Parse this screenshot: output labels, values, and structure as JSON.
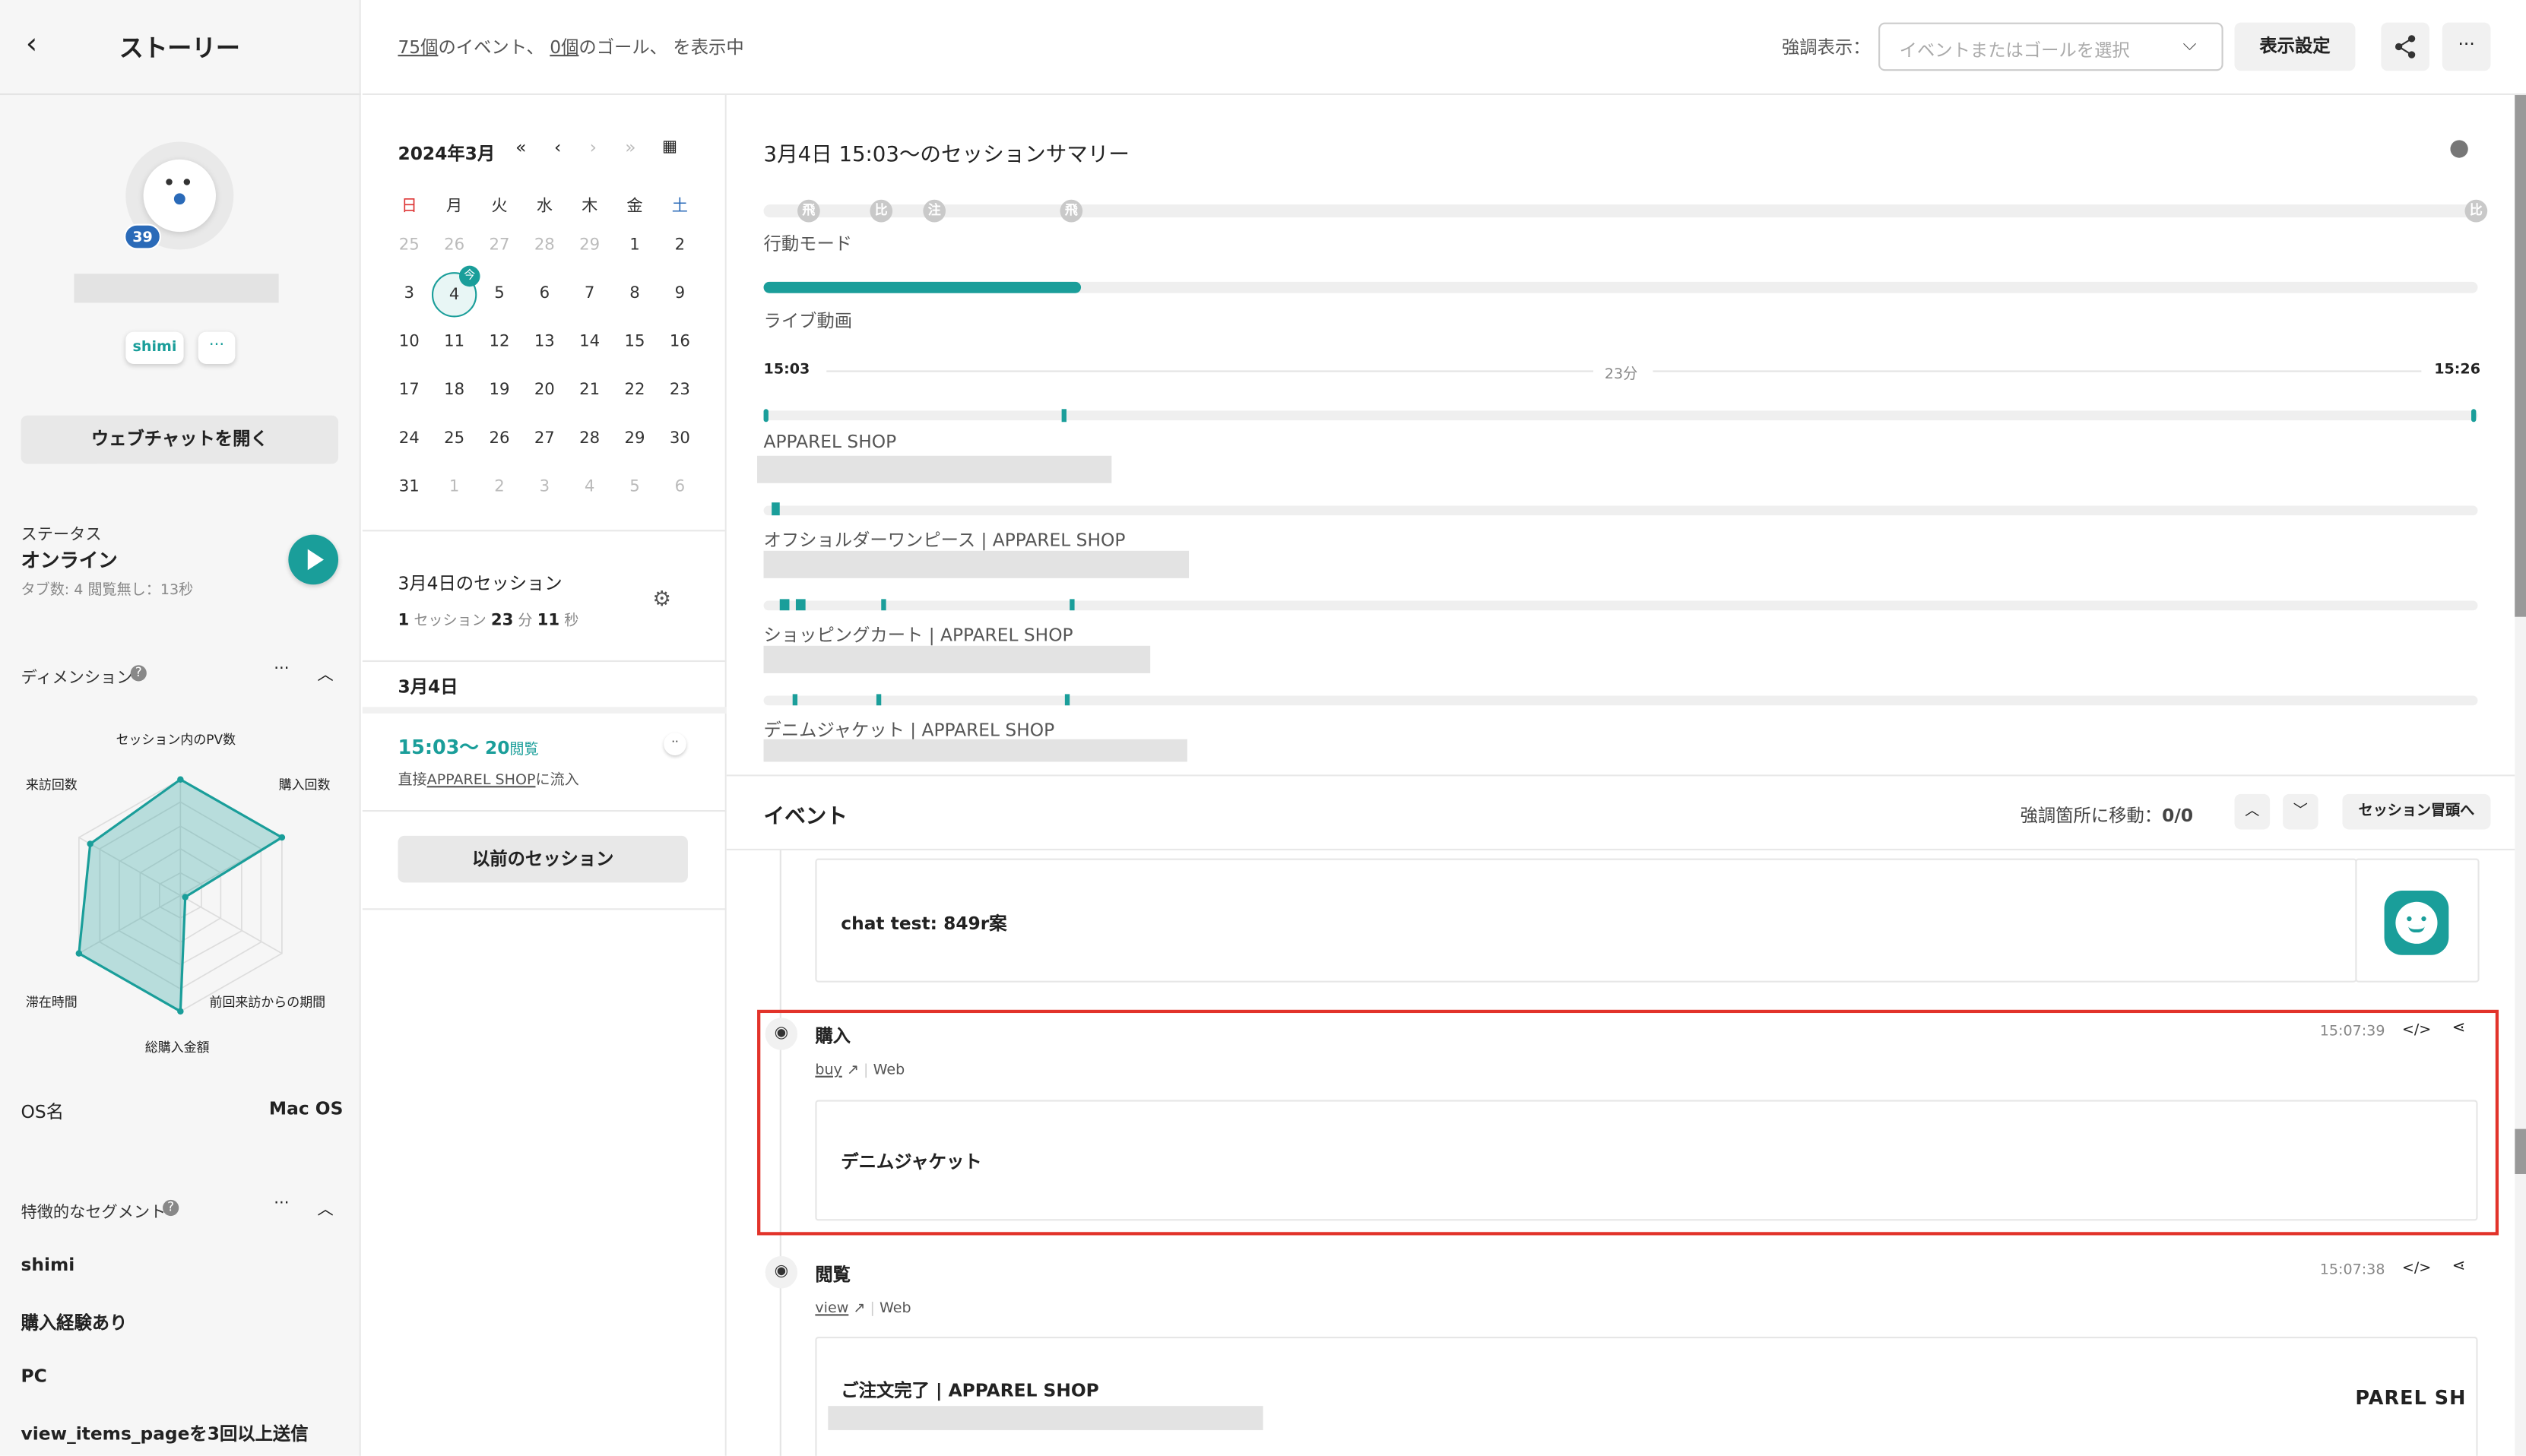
{
  "left": {
    "title": "ストーリー",
    "badge": "39",
    "tag": "shimi",
    "more": "···",
    "webchat_button": "ウェブチャットを開く",
    "status_label": "ステータス",
    "status_value": "オンライン",
    "status_detail": "タブ数: 4 閲覧無し：13秒",
    "dimension_title": "ディメンション",
    "radar_labels": {
      "top": "セッション内のPV数",
      "top_right": "購入回数",
      "top_left": "来訪回数",
      "bottom_right": "前回来訪からの期間",
      "bottom_left": "滞在時間",
      "bottom": "総購入金額"
    },
    "os_label": "OS名",
    "os_value": "Mac OS",
    "segment_title": "特徴的なセグメント",
    "segments": [
      "shimi",
      "購入経験あり",
      "PC",
      "view_items_pageを3回以上送信"
    ]
  },
  "topbar": {
    "events_count": "75個",
    "events_text": "のイベント、",
    "goals_count": "0個",
    "goals_text": "のゴール、 を表示中",
    "highlight_label": "強調表示：",
    "highlight_placeholder": "イベントまたはゴールを選択",
    "display_settings": "表示設定"
  },
  "calendar": {
    "month": "2024年3月",
    "weekdays": [
      "日",
      "月",
      "火",
      "水",
      "木",
      "金",
      "土"
    ],
    "weeks": [
      [
        "25",
        "26",
        "27",
        "28",
        "29",
        "1",
        "2"
      ],
      [
        "3",
        "4",
        "5",
        "6",
        "7",
        "8",
        "9"
      ],
      [
        "10",
        "11",
        "12",
        "13",
        "14",
        "15",
        "16"
      ],
      [
        "17",
        "18",
        "19",
        "20",
        "21",
        "22",
        "23"
      ],
      [
        "24",
        "25",
        "26",
        "27",
        "28",
        "29",
        "30"
      ],
      [
        "31",
        "1",
        "2",
        "3",
        "4",
        "5",
        "6"
      ]
    ],
    "today_badge": "今",
    "session_day_title": "3月4日のセッション",
    "session_count": "1",
    "session_unit": "セッション",
    "duration_min": "23",
    "min_unit": "分",
    "duration_sec": "11",
    "sec_unit": "秒",
    "day_label": "3月4日",
    "session_time": "15:03〜",
    "session_views": "20",
    "views_unit": "閲覧",
    "inflow_prefix": "直接",
    "inflow_link": "APPAREL SHOP",
    "inflow_suffix": "に流入",
    "prev_button": "以前のセッション"
  },
  "summary": {
    "title": "3月4日 15:03〜のセッションサマリー",
    "mode_label": "行動モード",
    "modes": [
      "飛",
      "比",
      "注",
      "飛",
      "比"
    ],
    "live_label": "ライブ動画",
    "live_progress": 0.185,
    "time_start": "15:03",
    "time_mid": "23分",
    "time_end": "15:26",
    "pages": [
      {
        "title": "APPAREL SHOP"
      },
      {
        "title": "オフショルダーワンピース | APPAREL SHOP"
      },
      {
        "title": "ショッピングカート | APPAREL SHOP"
      },
      {
        "title": "デニムジャケット | APPAREL SHOP"
      }
    ]
  },
  "events": {
    "title": "イベント",
    "jump_label": "強調箇所に移動：",
    "jump_count": "0/0",
    "session_top": "セッション冒頭へ",
    "chat_text": "chat test: 849r案",
    "items": [
      {
        "name": "購入",
        "time": "15:07:39",
        "link": "buy",
        "channel": "Web",
        "content": "デニムジャケット"
      },
      {
        "name": "閲覧",
        "time": "15:07:38",
        "link": "view",
        "channel": "Web",
        "content": "ご注文完了 | APPAREL SHOP",
        "thumb": "PAREL SH"
      }
    ]
  },
  "colors": {
    "accent": "#1a9e9a",
    "highlight_border": "#e2332a",
    "badge": "#2a6ab8"
  }
}
